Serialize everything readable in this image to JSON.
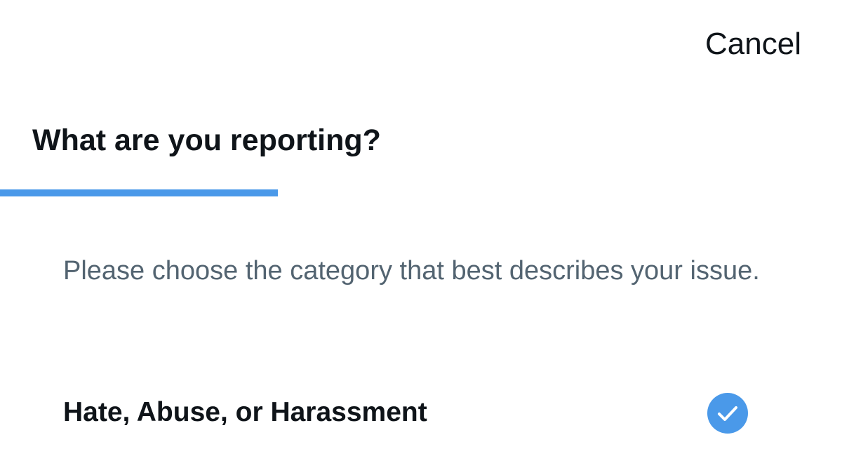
{
  "header": {
    "cancel_label": "Cancel"
  },
  "page": {
    "title": "What are you reporting?",
    "progress_fraction": 0.33,
    "instructions": "Please choose the category that best describes your issue."
  },
  "options": [
    {
      "label": "Hate, Abuse, or Harassment",
      "selected": true
    }
  ],
  "colors": {
    "accent": "#4a99e9",
    "text_primary": "#0f1419",
    "text_secondary": "#536471",
    "background": "#ffffff"
  },
  "icons": {
    "selected": "checkmark-circle-icon"
  }
}
